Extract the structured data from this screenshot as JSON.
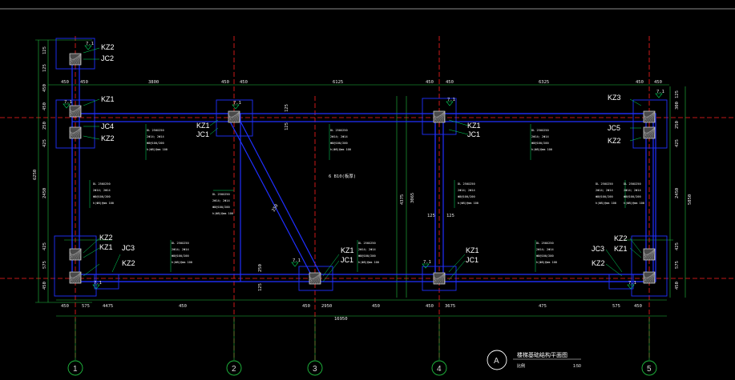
{
  "colors": {
    "background": "#000000",
    "axis_line": "#ff2020",
    "beam": "#2030ff",
    "dimension": "#20c040",
    "leader": "#00e060",
    "text": "#ffffff",
    "column_fill": "#555555"
  },
  "grid_axes": [
    {
      "label": "1"
    },
    {
      "label": "2"
    },
    {
      "label": "3"
    },
    {
      "label": "4"
    },
    {
      "label": "5"
    }
  ],
  "top_dims": {
    "row1": [
      "450",
      "450",
      "3800",
      "450",
      "450",
      "6125",
      "450",
      "450",
      "6325",
      "450",
      "450"
    ],
    "col_top_left": [
      "125",
      "125"
    ],
    "col_top_right": [
      "125",
      "300"
    ]
  },
  "bottom_dims": {
    "row1": [
      "450",
      "575",
      "4475",
      "450",
      "450",
      "2950",
      "450",
      "450",
      "3675",
      "475",
      "575",
      "450"
    ],
    "overall": "16950"
  },
  "left_dims": [
    "125",
    "125",
    "450",
    "450",
    "250",
    "425",
    "2450",
    "425",
    "575",
    "450"
  ],
  "left_total": "6250",
  "right_dims": [
    "450",
    "250",
    "425",
    "2450",
    "425",
    "575",
    "450"
  ],
  "right_total": "5850",
  "column_labels": [
    {
      "text": "KZ2"
    },
    {
      "text": "JC2"
    },
    {
      "text": "KZ1"
    },
    {
      "text": "JC4"
    },
    {
      "text": "KZ2"
    },
    {
      "text": "KZ2"
    },
    {
      "text": "KZ1"
    },
    {
      "text": "JC3"
    },
    {
      "text": "KZ2"
    },
    {
      "text": "KZ1"
    },
    {
      "text": "JC1"
    },
    {
      "text": "KZ1"
    },
    {
      "text": "JC1"
    },
    {
      "text": "KZ1"
    },
    {
      "text": "JC1"
    },
    {
      "text": "KZ1"
    },
    {
      "text": "JC1"
    },
    {
      "text": "KZ3"
    },
    {
      "text": "JC5"
    },
    {
      "text": "KZ2"
    },
    {
      "text": "KZ2"
    },
    {
      "text": "KZ1"
    },
    {
      "text": "JC3"
    },
    {
      "text": "KZ2"
    }
  ],
  "level_marks": [
    "7.1",
    "7.1",
    "7.1",
    "7.1",
    "7.1",
    "7.1",
    "7.1",
    "7.1",
    "7.1"
  ],
  "beam_notes": [
    [
      "DL 250X250",
      "2Φ14; 2Φ14",
      "Φ8@100/200",
      "h(Φ8)@mm 100"
    ],
    [
      "DL 250X250",
      "2Φ14; 2Φ14",
      "Φ8@100/200",
      "h(Φ8)@mm 100"
    ],
    [
      "DL 250X250",
      "2Φ14; 2Φ14",
      "Φ8@100/200",
      "h(Φ8)@mm 100"
    ],
    [
      "DL 250X250",
      "2Φ14; 2Φ14",
      "Φ8@100/200",
      "h(Φ8)@mm 100"
    ],
    [
      "DL 250X250",
      "2Φ14; 2Φ14",
      "Φ8@100/200",
      "h(Φ8)@mm 100"
    ],
    [
      "DL 250X250",
      "2Φ14; 2Φ14",
      "Φ8@100/200",
      "h(Φ8)@mm 100"
    ],
    [
      "DL 250X250",
      "2Φ14; 2Φ14",
      "Φ8@100/200",
      "h(Φ8)@mm 100"
    ],
    [
      "DL 250X250",
      "2Φ14; 2Φ14",
      "Φ8@100/200",
      "h(Φ8)@mm 100"
    ],
    [
      "DL 250X250",
      "2Φ14; 2Φ14",
      "Φ8@100/200",
      "h(Φ8)@mm 100"
    ],
    [
      "DL 250X250",
      "2Φ14; 2Φ14",
      "Φ8@100/200",
      "h(Φ8)@mm 100"
    ],
    [
      "DL 250X250",
      "2Φ14; 2Φ14",
      "Φ8@100/200",
      "h(Φ8)@mm 100"
    ]
  ],
  "slab_note": "6 B10(板厚)",
  "diag_label": "250",
  "inner_dims": {
    "mid_left": [
      "4375",
      "3065"
    ],
    "mid_right": [
      "125",
      "125"
    ],
    "small": [
      "125",
      "125",
      "250",
      "125"
    ]
  },
  "title_block": {
    "axis_letter": "A",
    "title": "楼梯基础结构平面图",
    "scale_left": "比例",
    "scale_right": "1:50"
  }
}
